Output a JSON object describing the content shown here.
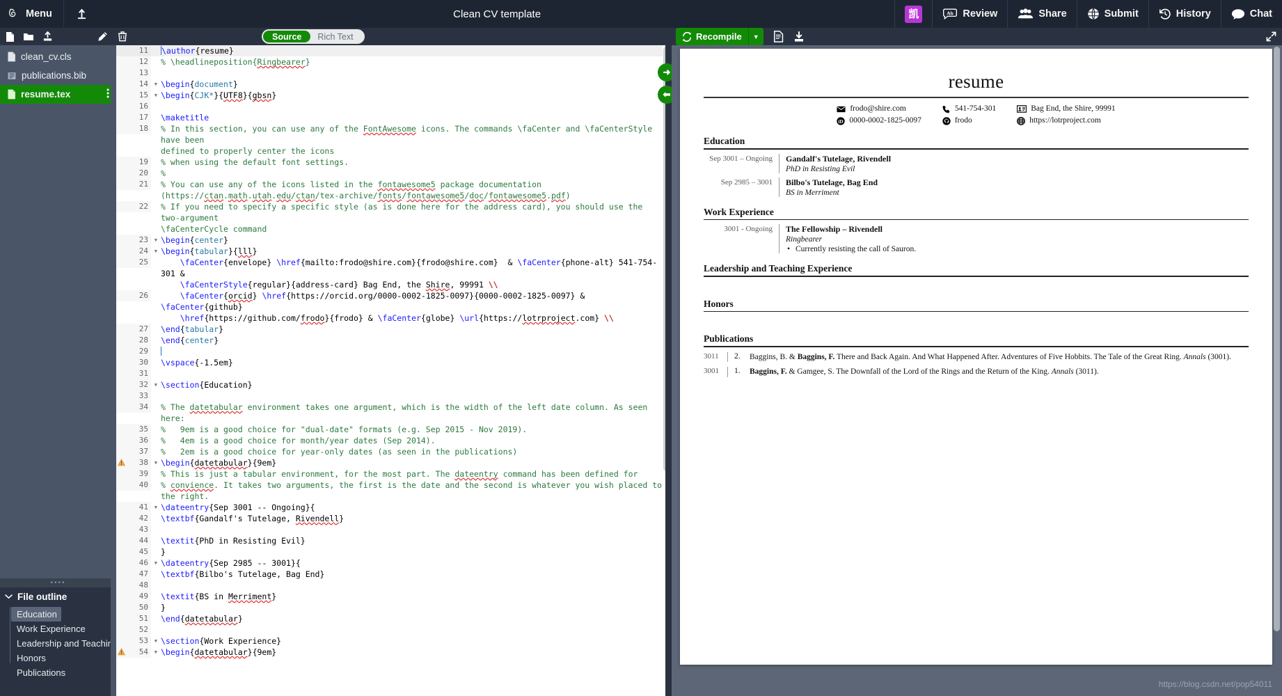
{
  "topnav": {
    "menu_label": "Menu",
    "title": "Clean CV template",
    "cjk_badge": "凯",
    "review_label": "Review",
    "share_label": "Share",
    "submit_label": "Submit",
    "history_label": "History",
    "chat_label": "Chat",
    "bg_color": "#1e2532"
  },
  "subbar": {
    "mode_source": "Source",
    "mode_rich": "Rich Text",
    "recompile_label": "Recompile",
    "recompile_color": "#138a07"
  },
  "sidebar": {
    "files": [
      {
        "name": "clean_cv.cls",
        "icon": "file-icon",
        "active": false
      },
      {
        "name": "publications.bib",
        "icon": "bib-file-icon",
        "active": false
      },
      {
        "name": "resume.tex",
        "icon": "tex-file-icon",
        "active": true
      }
    ],
    "outline_header": "File outline",
    "outline": [
      {
        "label": "Education",
        "active": true
      },
      {
        "label": "Work Experience",
        "active": false
      },
      {
        "label": "Leadership and Teaching ...",
        "active": false
      },
      {
        "label": "Honors",
        "active": false
      },
      {
        "label": "Publications",
        "active": false
      }
    ]
  },
  "editor": {
    "lines": [
      {
        "n": "11",
        "hl": true,
        "fold": false,
        "warn": false,
        "html": "<span class=\"caret\"></span><span class=\"kw\">\\author</span>{resume}"
      },
      {
        "n": "12",
        "hl": false,
        "fold": false,
        "warn": false,
        "html": "<span class=\"cmt\">% \\headlineposition{<span class=\"sp\">Ringbearer</span>}</span>"
      },
      {
        "n": "13",
        "hl": false,
        "fold": false,
        "warn": false,
        "html": ""
      },
      {
        "n": "14",
        "hl": false,
        "fold": true,
        "warn": false,
        "html": "<span class=\"kw\">\\begin</span>{<span class=\"brc\">document</span>}"
      },
      {
        "n": "15",
        "hl": false,
        "fold": true,
        "warn": false,
        "html": "<span class=\"kw\">\\begin</span>{<span class=\"brc\">CJK*</span>}{<span class=\"sp\">UTF8</span>}{<span class=\"sp\">gbsn</span>}"
      },
      {
        "n": "16",
        "hl": false,
        "fold": false,
        "warn": false,
        "html": ""
      },
      {
        "n": "17",
        "hl": false,
        "fold": false,
        "warn": false,
        "html": "<span class=\"kw\">\\maketitle</span>"
      },
      {
        "n": "18",
        "hl": false,
        "fold": false,
        "warn": false,
        "html": "<span class=\"cmt\">% In this section, you can use any of the <span class=\"sp\">FontAwesome</span> icons. The commands \\faCenter and \\faCenterStyle have been\ndefined to properly center the icons</span>"
      },
      {
        "n": "19",
        "hl": false,
        "fold": false,
        "warn": false,
        "html": "<span class=\"cmt\">% when using the default font settings.</span>"
      },
      {
        "n": "20",
        "hl": false,
        "fold": false,
        "warn": false,
        "html": "<span class=\"cmt\">%</span>"
      },
      {
        "n": "21",
        "hl": false,
        "fold": false,
        "warn": false,
        "html": "<span class=\"cmt\">% You can use any of the icons listed in the <span class=\"sp\">fontawesome5</span> package documentation\n(https://<span class=\"sp\">ctan</span>.<span class=\"sp\">math</span>.<span class=\"sp\">utah</span>.<span class=\"sp\">edu</span>/<span class=\"sp\">ctan</span>/tex-archive/<span class=\"sp\">fonts</span>/<span class=\"sp\">fontawesome5</span>/<span class=\"sp\">doc</span>/<span class=\"sp\">fontawesome5</span>.<span class=\"sp\">pdf</span>)</span>"
      },
      {
        "n": "22",
        "hl": false,
        "fold": false,
        "warn": false,
        "html": "<span class=\"cmt\">% If you need to specify a specific style (as is done here for the address card), you should use the two-argument\n\\faCenterCycle command</span>"
      },
      {
        "n": "23",
        "hl": false,
        "fold": true,
        "warn": false,
        "html": "<span class=\"kw\">\\begin</span>{<span class=\"brc\">center</span>}"
      },
      {
        "n": "24",
        "hl": false,
        "fold": true,
        "warn": false,
        "html": "<span class=\"kw\">\\begin</span>{<span class=\"brc\">tabular</span>}{<span class=\"sp\">lll</span>}"
      },
      {
        "n": "25",
        "hl": false,
        "fold": false,
        "warn": false,
        "html": "    <span class=\"kw\">\\faCenter</span>{envelope} <span class=\"kw\">\\href</span>{mailto:frodo@shire.com}{frodo@shire.com}  &amp; <span class=\"kw\">\\faCenter</span>{phone-alt} 541-754-301 &amp;\n    <span class=\"kw\">\\faCenterStyle</span>{regular}{address-card} Bag End, the <span class=\"sp\">Shire</span>, 99991 <span class=\"red\">\\\\</span>"
      },
      {
        "n": "26",
        "hl": false,
        "fold": false,
        "warn": false,
        "html": "    <span class=\"kw\">\\faCenter</span>{<span class=\"sp\">orcid</span>} <span class=\"kw\">\\href</span>{https://orcid.org/0000-0002-1825-0097}{0000-0002-1825-0097} &amp; <span class=\"kw\">\\faCenter</span>{github}\n    <span class=\"kw\">\\href</span>{https://github.com/<span class=\"sp\">frodo</span>}{frodo} &amp; <span class=\"kw\">\\faCenter</span>{globe} <span class=\"kw\">\\url</span>{https://<span class=\"sp\">lotrproject</span>.com} <span class=\"red\">\\\\</span>"
      },
      {
        "n": "27",
        "hl": false,
        "fold": false,
        "warn": false,
        "html": "<span class=\"kw\">\\end</span>{<span class=\"brc\">tabular</span>}"
      },
      {
        "n": "28",
        "hl": false,
        "fold": false,
        "warn": false,
        "html": "<span class=\"kw\">\\end</span>{<span class=\"brc\">center</span>}"
      },
      {
        "n": "29",
        "hl": false,
        "fold": false,
        "warn": false,
        "html": "<span class=\"caret\"></span>"
      },
      {
        "n": "30",
        "hl": false,
        "fold": false,
        "warn": false,
        "html": "<span class=\"kw\">\\vspace</span>{-1.5em}"
      },
      {
        "n": "31",
        "hl": false,
        "fold": false,
        "warn": false,
        "html": ""
      },
      {
        "n": "32",
        "hl": false,
        "fold": true,
        "warn": false,
        "html": "<span class=\"kw\">\\section</span>{Education}"
      },
      {
        "n": "33",
        "hl": false,
        "fold": false,
        "warn": false,
        "html": ""
      },
      {
        "n": "34",
        "hl": false,
        "fold": false,
        "warn": false,
        "html": "<span class=\"cmt\">% The <span class=\"sp\">datetabular</span> environment takes one argument, which is the width of the left date column. As seen here:</span>"
      },
      {
        "n": "35",
        "hl": false,
        "fold": false,
        "warn": false,
        "html": "<span class=\"cmt\">%   9em is a good choice for \"dual-date\" formats (e.g. Sep 2015 - Nov 2019).</span>"
      },
      {
        "n": "36",
        "hl": false,
        "fold": false,
        "warn": false,
        "html": "<span class=\"cmt\">%   4em is a good choice for month/year dates (Sep 2014).</span>"
      },
      {
        "n": "37",
        "hl": false,
        "fold": false,
        "warn": false,
        "html": "<span class=\"cmt\">%   2em is a good choice for year-only dates (as seen in the publications)</span>"
      },
      {
        "n": "38",
        "hl": false,
        "fold": true,
        "warn": true,
        "html": "<span class=\"kw\">\\begin</span>{<span class=\"sp\">datetabular</span>}{9em}"
      },
      {
        "n": "39",
        "hl": false,
        "fold": false,
        "warn": false,
        "html": "<span class=\"cmt\">% This is just a tabular environment, for the most part. The <span class=\"sp\">dateentry</span> command has been defined for</span>"
      },
      {
        "n": "40",
        "hl": false,
        "fold": false,
        "warn": false,
        "html": "<span class=\"cmt\">% <span class=\"sp\">convience</span>. It takes two arguments, the first is the date and the second is whatever you wish placed to the right.</span>"
      },
      {
        "n": "41",
        "hl": false,
        "fold": true,
        "warn": false,
        "html": "<span class=\"kw\">\\dateentry</span>{Sep 3001 -- Ongoing}{"
      },
      {
        "n": "42",
        "hl": false,
        "fold": false,
        "warn": false,
        "html": "<span class=\"kw\">\\textbf</span>{Gandalf's Tutelage, <span class=\"sp\">Rivendell</span>}"
      },
      {
        "n": "43",
        "hl": false,
        "fold": false,
        "warn": false,
        "html": ""
      },
      {
        "n": "44",
        "hl": false,
        "fold": false,
        "warn": false,
        "html": "<span class=\"kw\">\\textit</span>{PhD in Resisting Evil}"
      },
      {
        "n": "45",
        "hl": false,
        "fold": false,
        "warn": false,
        "html": "}"
      },
      {
        "n": "46",
        "hl": false,
        "fold": true,
        "warn": false,
        "html": "<span class=\"kw\">\\dateentry</span>{Sep 2985 -- 3001}{"
      },
      {
        "n": "47",
        "hl": false,
        "fold": false,
        "warn": false,
        "html": "<span class=\"kw\">\\textbf</span>{Bilbo's Tutelage, Bag End}"
      },
      {
        "n": "48",
        "hl": false,
        "fold": false,
        "warn": false,
        "html": ""
      },
      {
        "n": "49",
        "hl": false,
        "fold": false,
        "warn": false,
        "html": "<span class=\"kw\">\\textit</span>{BS in <span class=\"sp\">Merriment</span>}"
      },
      {
        "n": "50",
        "hl": false,
        "fold": false,
        "warn": false,
        "html": "}"
      },
      {
        "n": "51",
        "hl": false,
        "fold": false,
        "warn": false,
        "html": "<span class=\"kw\">\\end</span>{<span class=\"sp\">datetabular</span>}"
      },
      {
        "n": "52",
        "hl": false,
        "fold": false,
        "warn": false,
        "html": ""
      },
      {
        "n": "53",
        "hl": false,
        "fold": true,
        "warn": false,
        "html": "<span class=\"kw\">\\section</span>{Work Experience}"
      },
      {
        "n": "54",
        "hl": false,
        "fold": true,
        "warn": true,
        "html": "<span class=\"kw\">\\begin</span>{<span class=\"sp\">datetabular</span>}{9em}"
      }
    ]
  },
  "pdf": {
    "title": "resume",
    "contact": {
      "col1": [
        {
          "icon": "envelope-icon",
          "text": "frodo@shire.com"
        },
        {
          "icon": "orcid-icon",
          "text": "0000-0002-1825-0097"
        }
      ],
      "col2": [
        {
          "icon": "phone-icon",
          "text": "541-754-301"
        },
        {
          "icon": "github-icon",
          "text": "frodo"
        }
      ],
      "col3": [
        {
          "icon": "address-card-icon",
          "text": "Bag End, the Shire, 99991"
        },
        {
          "icon": "globe-icon",
          "text": "https://lotrproject.com"
        }
      ]
    },
    "sections": [
      {
        "title": "Education",
        "entries": [
          {
            "date": "Sep 3001 – Ongoing",
            "title": "Gandalf's Tutelage, Rivendell",
            "sub": "PhD in Resisting Evil",
            "bullets": []
          },
          {
            "date": "Sep 2985 – 3001",
            "title": "Bilbo's Tutelage, Bag End",
            "sub": "BS in Merriment",
            "bullets": []
          }
        ]
      },
      {
        "title": "Work Experience",
        "entries": [
          {
            "date": "3001 - Ongoing",
            "title": "The Fellowship – Rivendell",
            "sub": "Ringbearer",
            "bullets": [
              "Currently resisting the call of Sauron."
            ]
          }
        ]
      },
      {
        "title": "Leadership and Teaching Experience",
        "entries": []
      },
      {
        "title": "Honors",
        "entries": []
      }
    ],
    "publications_title": "Publications",
    "publications": [
      {
        "year": "3011",
        "num": "2.",
        "authors_plain": "Baggins, B. & ",
        "authors_bold": "Baggins, F.",
        "rest": " There and Back Again. And What Happened After. Adventures of Five Hobbits. The Tale of the Great Ring. ",
        "journal": "Annals",
        "tail": " (3001)."
      },
      {
        "year": "3001",
        "num": "1.",
        "authors_plain": "",
        "authors_bold": "Baggins, F.",
        "rest": " & Gamgee, S. The Downfall of the Lord of the Rings and the Return of the King. ",
        "journal": "Annals",
        "tail": " (3011)."
      }
    ],
    "watermark": "https://blog.csdn.net/pop54011"
  }
}
